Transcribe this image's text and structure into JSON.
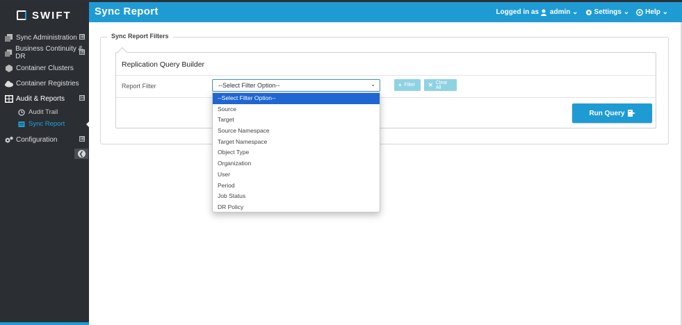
{
  "brand": {
    "name": "SWIFT"
  },
  "sidebar": {
    "items": [
      {
        "label": "Sync Administration",
        "icon": "copy-icon",
        "toggle": "⊞"
      },
      {
        "label": "Business Continuity & DR",
        "icon": "copy-icon",
        "toggle": "⊞"
      },
      {
        "label": "Container Clusters",
        "icon": "cube-icon"
      },
      {
        "label": "Container Registries",
        "icon": "cloud-icon"
      },
      {
        "label": "Audit & Reports",
        "icon": "table-icon",
        "toggle": "⊟"
      },
      {
        "label": "Configuration",
        "icon": "gears-icon",
        "toggle": "⊞"
      }
    ],
    "subitems": [
      {
        "label": "Audit Trail",
        "icon": "history-icon"
      },
      {
        "label": "Sync Report",
        "icon": "report-icon"
      }
    ]
  },
  "header": {
    "title": "Sync Report",
    "logged_in_label": "Logged in as",
    "user": "admin",
    "settings": "Settings",
    "help": "Help"
  },
  "content": {
    "legend": "Sync Report Filters",
    "panel_title": "Replication Query Builder",
    "filter_label": "Report Filter",
    "select_value": "--Select Filter Option--",
    "filter_button": "Filter",
    "clear_button": "Clear All",
    "run_button": "Run Query"
  },
  "dropdown": {
    "options": [
      "--Select Filter Option--",
      "Source",
      "Target",
      "Source Namespace",
      "Target Namespace",
      "Object Type",
      "Organization",
      "User",
      "Period",
      "Job Status",
      "DR Policy"
    ],
    "selected_index": 0
  },
  "colors": {
    "accent": "#1f9bd4",
    "sidebar_bg": "#2b2e33",
    "selected_option": "#1f66d1",
    "small_button": "#8fd3e3"
  }
}
